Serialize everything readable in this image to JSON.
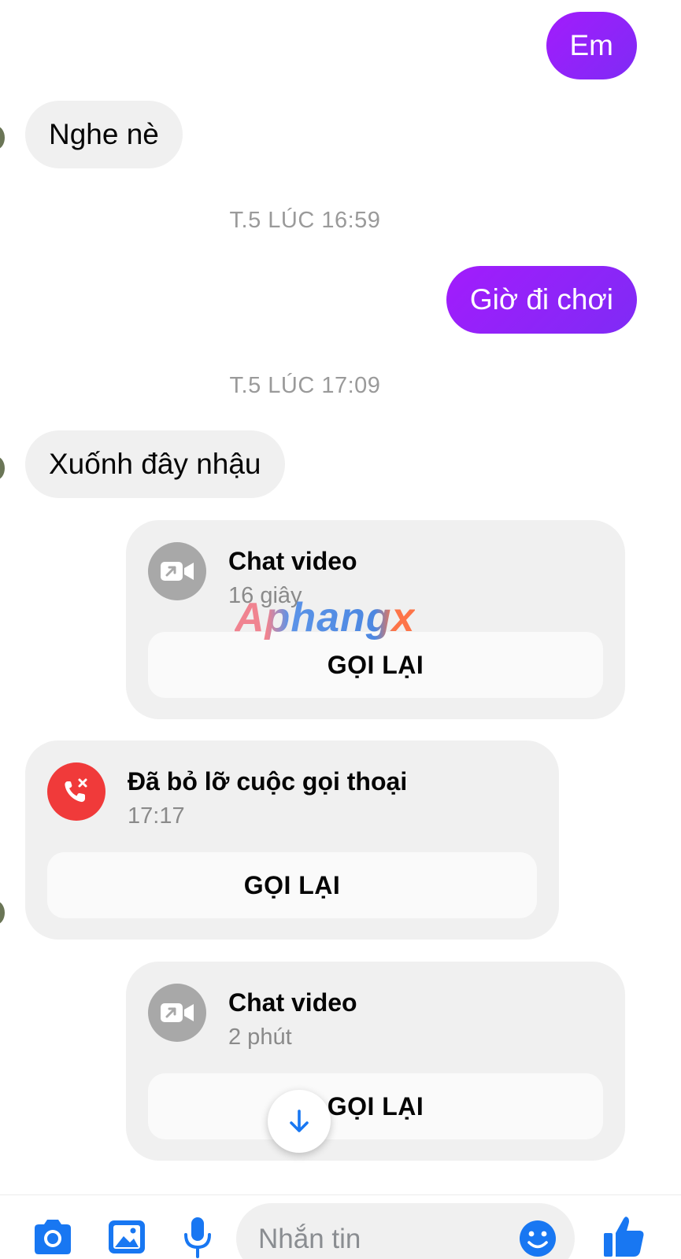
{
  "messages": {
    "m1": "Em",
    "m2": "Nghe nè",
    "ts1": "T.5 LÚC 16:59",
    "m3": "Giờ đi chơi",
    "ts2": "T.5 LÚC 17:09",
    "m4": "Xuốnh đây nhậu"
  },
  "calls": [
    {
      "title": "Chat video",
      "subtitle": "16 giây",
      "button": "GỌI LẠI"
    },
    {
      "title": "Đã bỏ lỡ cuộc gọi thoại",
      "subtitle": "17:17",
      "button": "GỌI LẠI"
    },
    {
      "title": "Chat video",
      "subtitle": "2 phút",
      "button": "GỌI LẠI"
    }
  ],
  "watermark": "Aphangx",
  "composer": {
    "placeholder": "Nhắn tin",
    "icons": [
      "camera-icon",
      "gallery-icon",
      "microphone-icon",
      "emoji-icon",
      "like-icon"
    ]
  },
  "colors": {
    "outgoing_bubble": "#9b1ffc",
    "incoming_bubble": "#f0f0f0",
    "messenger_blue": "#0084ff",
    "missed_call_red": "#f03a3a"
  }
}
